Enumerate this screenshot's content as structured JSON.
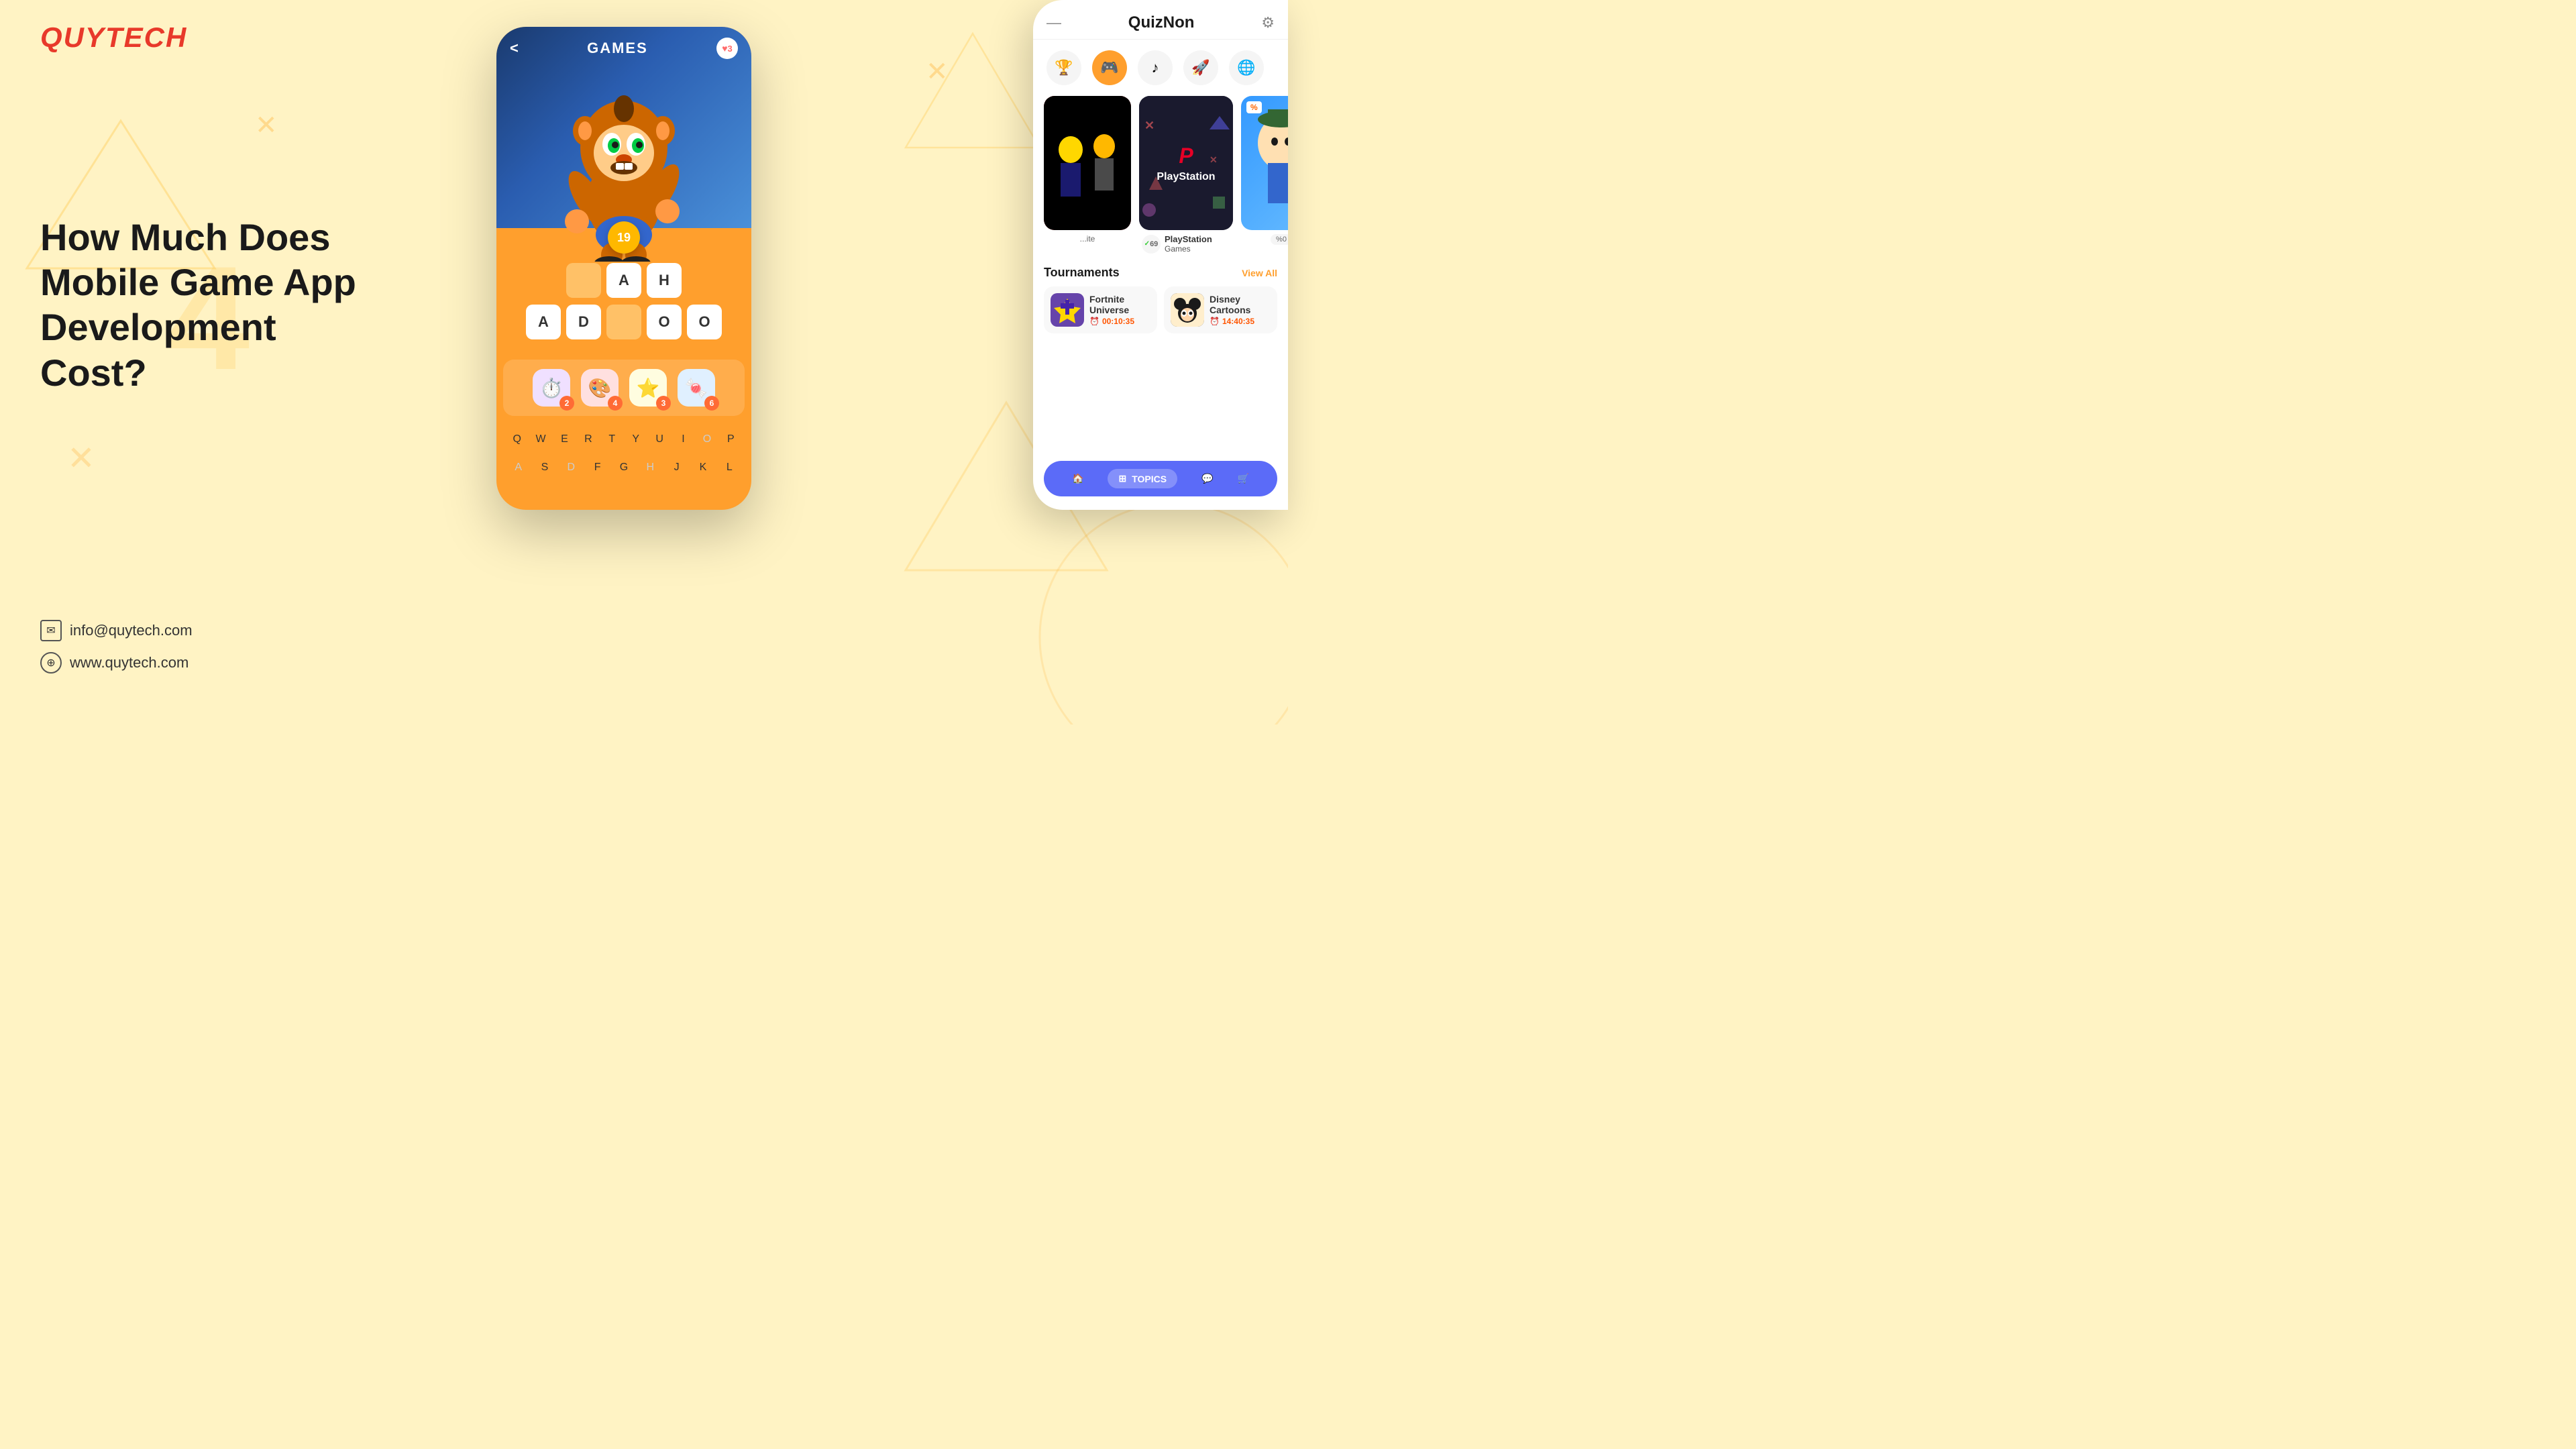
{
  "brand": {
    "logo": "QUYTECH",
    "tagline": ""
  },
  "hero": {
    "heading": "How Much Does Mobile Game App Development Cost?"
  },
  "contact": {
    "email": "info@quytech.com",
    "website": "www.quytech.com"
  },
  "game_app": {
    "title": "GAMES",
    "back_label": "<",
    "hearts": "3",
    "score": "19",
    "word_rows": [
      [
        "",
        "A",
        "H"
      ],
      [
        "A",
        "D",
        "",
        "O",
        "O"
      ]
    ],
    "keyboard_row1": [
      "Q",
      "W",
      "E",
      "R",
      "T",
      "Y",
      "U",
      "I",
      "O",
      "P"
    ],
    "keyboard_row2": [
      "A",
      "S",
      "D",
      "F",
      "G",
      "H",
      "J",
      "K",
      "L"
    ],
    "powerups": [
      {
        "icon": "⏱",
        "count": "2"
      },
      {
        "icon": "🎨",
        "count": "4"
      },
      {
        "icon": "⭐",
        "count": "3"
      },
      {
        "icon": "🍬",
        "count": "6"
      }
    ]
  },
  "quiz_app": {
    "title": "QuizNon",
    "categories": [
      {
        "icon": "🎮",
        "active": true
      },
      {
        "icon": "♪",
        "active": false
      },
      {
        "icon": "🚀",
        "active": false
      },
      {
        "icon": "🌐",
        "active": false
      },
      {
        "icon": "🏆",
        "active": false
      }
    ],
    "game_cards": [
      {
        "type": "ps",
        "brand": "PlayStation",
        "rating": "69",
        "label": "PlayStation Games"
      }
    ],
    "tournaments": {
      "title": "Tournaments",
      "view_all": "View All",
      "items": [
        {
          "name": "Fortnite Universe",
          "time": "00:10:35",
          "color": "#FF5500"
        },
        {
          "name": "Disney Cartoons",
          "time": "14:40:35",
          "color": "#FF5500"
        }
      ]
    },
    "nav": {
      "items": [
        {
          "icon": "🏠",
          "label": "",
          "active": false
        },
        {
          "icon": "⊞",
          "label": "TOPICS",
          "active": true
        },
        {
          "icon": "💬",
          "label": "",
          "active": false
        },
        {
          "icon": "🛒",
          "label": "",
          "active": false
        }
      ]
    }
  },
  "colors": {
    "primary_orange": "#FF9F2D",
    "background": "#FFF3C4",
    "logo_red": "#E8392A",
    "nav_blue": "#5B6BF8",
    "ps_dark": "#1a1a2e",
    "ps_red": "#E60026"
  }
}
